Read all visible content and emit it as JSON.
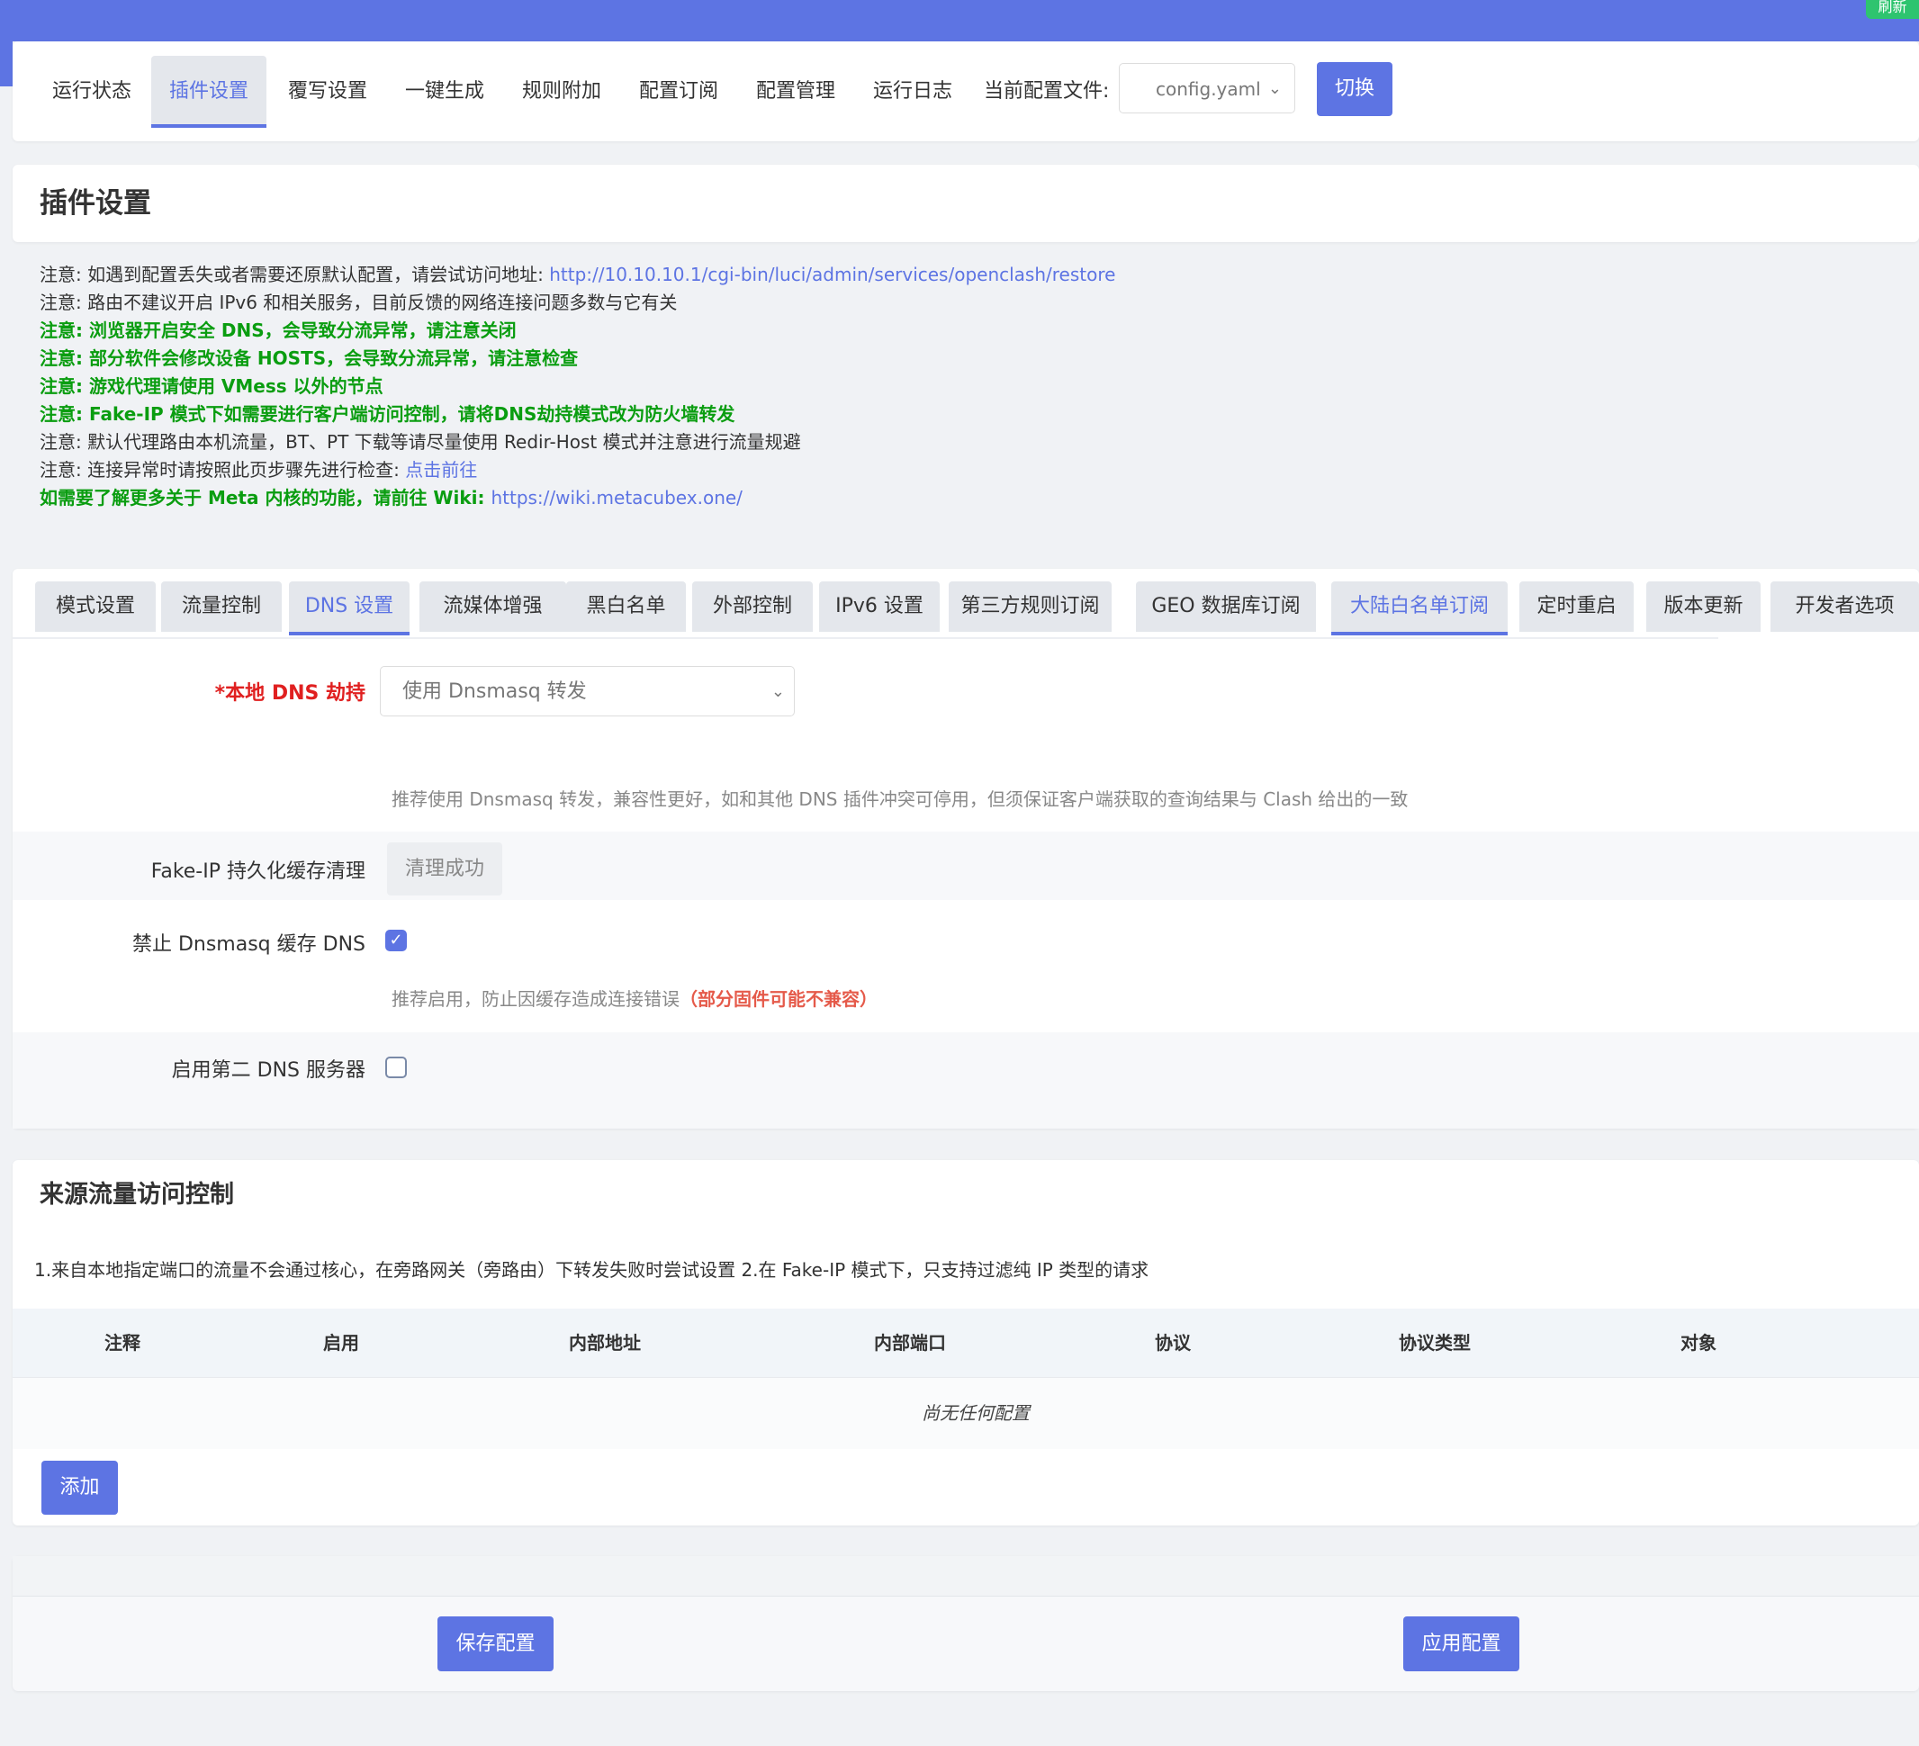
{
  "top_bar": {
    "refresh_label": "刷新"
  },
  "nav": {
    "tabs": [
      "运行状态",
      "插件设置",
      "覆写设置",
      "一键生成",
      "规则附加",
      "配置订阅",
      "配置管理",
      "运行日志"
    ],
    "active_tab": "插件设置",
    "config_label": "当前配置文件:",
    "config_value": "config.yaml",
    "switch_label": "切换"
  },
  "page_title": "插件设置",
  "notes": {
    "n1_text": "注意: 如遇到配置丢失或者需要还原默认配置，请尝试访问地址: ",
    "n1_link": "http://10.10.10.1/cgi-bin/luci/admin/services/openclash/restore",
    "n2": "注意: 路由不建议开启 IPv6 和相关服务，目前反馈的网络连接问题多数与它有关",
    "n3": "注意: 浏览器开启安全 DNS，会导致分流异常，请注意关闭",
    "n4": "注意: 部分软件会修改设备 HOSTS，会导致分流异常，请注意检查",
    "n5": "注意: 游戏代理请使用 VMess 以外的节点",
    "n6": "注意: Fake-IP 模式下如需要进行客户端访问控制，请将DNS劫持模式改为防火墙转发",
    "n7": "注意: 默认代理路由本机流量，BT、PT 下载等请尽量使用 Redir-Host 模式并注意进行流量规避",
    "n8_text": "注意: 连接异常时请按照此页步骤先进行检查: ",
    "n8_link": "点击前往",
    "n9_text": "如需要了解更多关于 Meta 内核的功能，请前往 Wiki: ",
    "n9_link": "https://wiki.metacubex.one/"
  },
  "settings": {
    "tabs": [
      "模式设置",
      "流量控制",
      "DNS 设置",
      "流媒体增强",
      "黑白名单",
      "外部控制",
      "IPv6 设置",
      "第三方规则订阅",
      "GEO 数据库订阅",
      "大陆白名单订阅",
      "定时重启",
      "版本更新",
      "开发者选项"
    ],
    "active_tabs": [
      "DNS 设置",
      "大陆白名单订阅"
    ],
    "local_dns_label": "*本地 DNS 劫持",
    "local_dns_value": "使用 Dnsmasq 转发",
    "local_dns_desc": "推荐使用 Dnsmasq 转发，兼容性更好，如和其他 DNS 插件冲突可停用，但须保证客户端获取的查询结果与 Clash 给出的一致",
    "fakeip_label": "Fake-IP 持久化缓存清理",
    "fakeip_button": "清理成功",
    "dnsmasq_cache_label": "禁止 Dnsmasq 缓存 DNS",
    "dnsmasq_cache_checked": true,
    "dnsmasq_cache_desc": "推荐启用，防止因缓存造成连接错误",
    "dnsmasq_cache_warn": "（部分固件可能不兼容）",
    "second_dns_label": "启用第二 DNS 服务器",
    "second_dns_checked": false
  },
  "access_control": {
    "title": "来源流量访问控制",
    "intro": "1.来自本地指定端口的流量不会通过核心，在旁路网关（旁路由）下转发失败时尝试设置 2.在 Fake-IP 模式下，只支持过滤纯 IP 类型的请求",
    "columns": [
      "注释",
      "启用",
      "内部地址",
      "内部端口",
      "协议",
      "协议类型",
      "对象"
    ],
    "empty_text": "尚无任何配置",
    "add_label": "添加"
  },
  "actions": {
    "save_label": "保存配置",
    "apply_label": "应用配置"
  },
  "colors": {
    "accent": "#5d74e3",
    "note_green": "#0a9d10",
    "required_red": "#e02020",
    "warn_red": "#e55a4a"
  }
}
